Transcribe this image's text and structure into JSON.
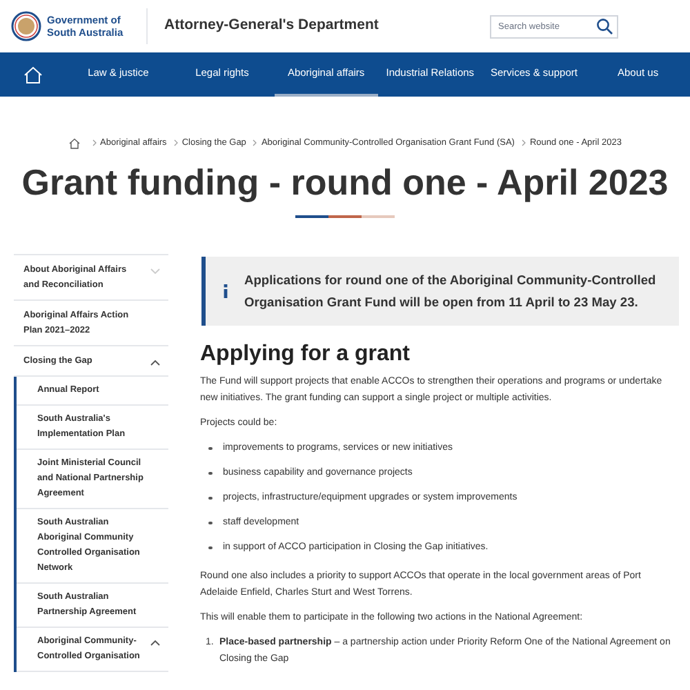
{
  "header": {
    "logo_text": "Government of South Australia",
    "department": "Attorney-General's Department",
    "search": {
      "placeholder": "Search website"
    }
  },
  "nav": [
    {
      "label": "Law & justice",
      "selected": false
    },
    {
      "label": "Legal rights",
      "selected": false
    },
    {
      "label": "Aboriginal affairs",
      "selected": true
    },
    {
      "label": "Industrial Relations",
      "selected": false
    },
    {
      "label": "Services & support",
      "selected": false
    },
    {
      "label": "About us",
      "selected": false
    }
  ],
  "breadcrumb": [
    "Aboriginal affairs",
    "Closing the Gap",
    "Aboriginal Community-Controlled Organisation Grant Fund (SA)",
    "Round one - April 2023"
  ],
  "title": "Grant funding - round one - April 2023",
  "sidebar": {
    "items": [
      {
        "label": "About Aboriginal Affairs and Reconciliation",
        "expanded": false
      },
      {
        "label": "Aboriginal Affairs Action Plan 2021–2022"
      },
      {
        "label": "Closing the Gap",
        "expanded": true,
        "children": [
          {
            "label": "Annual Report"
          },
          {
            "label": "South Australia's Implementation Plan"
          },
          {
            "label": "Joint Ministerial Council and National Partnership Agreement"
          },
          {
            "label": "South Australian Aboriginal Community Controlled Organisation Network"
          },
          {
            "label": "South Australian Partnership Agreement"
          },
          {
            "label": "Aboriginal Community-Controlled Organisation",
            "expanded": true
          }
        ]
      }
    ]
  },
  "notice": "Applications for round one of the Aboriginal Community-Controlled Organisation Grant Fund will be open from 11 April to 23 May 23.",
  "content": {
    "heading": "Applying for a grant",
    "intro": "The Fund will support projects that enable ACCOs to strengthen their operations and programs or undertake new initiatives. The grant funding can support a single project or multiple activities.",
    "list_intro": "Projects could be:",
    "bullets": [
      "improvements to programs, services or new initiatives",
      "business capability and governance projects",
      "projects, infrastructure/equipment upgrades or system improvements",
      "staff development",
      "in support of ACCO participation in Closing the Gap initiatives."
    ],
    "paragraphs": [
      "Round one also includes a priority to support ACCOs that operate in the local government areas of Port Adelaide Enfield, Charles Sturt and West Torrens.",
      "This will enable them to participate in the following two actions in the National Agreement:"
    ],
    "numbered": [
      {
        "number": "1.",
        "text": "**Place-based partnership** – a partnership action under Priority Reform One of the National Agreement on Closing the Gap"
      }
    ]
  }
}
